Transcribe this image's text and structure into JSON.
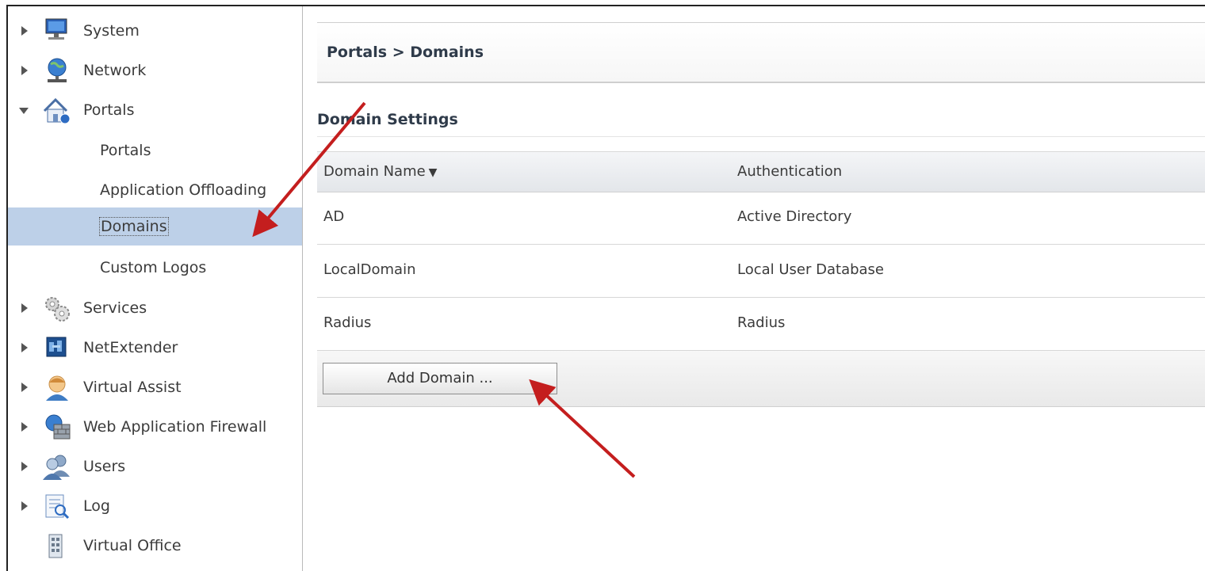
{
  "sidebar": {
    "items": [
      {
        "label": "System",
        "icon": "monitor-icon"
      },
      {
        "label": "Network",
        "icon": "network-globe-icon"
      },
      {
        "label": "Portals",
        "icon": "portal-house-icon"
      },
      {
        "label": "Services",
        "icon": "gears-icon"
      },
      {
        "label": "NetExtender",
        "icon": "netextender-icon"
      },
      {
        "label": "Virtual Assist",
        "icon": "assist-person-icon"
      },
      {
        "label": "Web Application Firewall",
        "icon": "firewall-globe-icon"
      },
      {
        "label": "Users",
        "icon": "users-icon"
      },
      {
        "label": "Log",
        "icon": "log-icon"
      },
      {
        "label": "Virtual Office",
        "icon": "building-icon"
      }
    ],
    "portals_subitems": [
      {
        "label": "Portals"
      },
      {
        "label": "Application Offloading"
      },
      {
        "label": "Domains",
        "selected": true
      },
      {
        "label": "Custom Logos"
      }
    ]
  },
  "header": {
    "title": "Portals > Domains"
  },
  "section": {
    "title": "Domain Settings"
  },
  "table": {
    "columns": [
      "Domain Name",
      "Authentication"
    ],
    "sort_indicator": "▼",
    "rows": [
      {
        "domain": "AD",
        "auth": "Active Directory"
      },
      {
        "domain": "LocalDomain",
        "auth": "Local User Database"
      },
      {
        "domain": "Radius",
        "auth": "Radius"
      }
    ]
  },
  "actions": {
    "add_domain_label": "Add Domain ..."
  },
  "colors": {
    "selected_bg": "#bdd0e8",
    "annotation_arrow": "#c41e1e"
  }
}
